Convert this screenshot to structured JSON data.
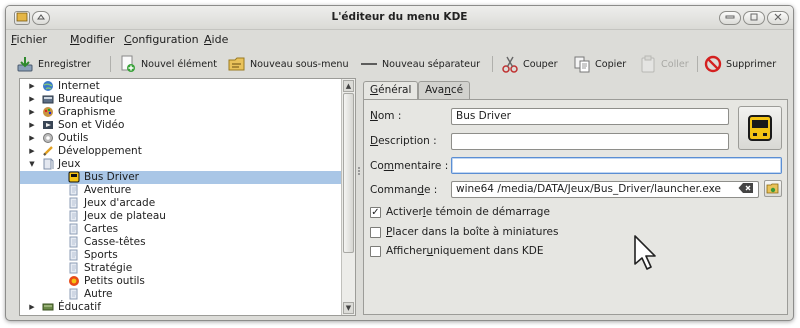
{
  "window": {
    "title": "L'éditeur du menu KDE"
  },
  "menubar": [
    {
      "pre": "",
      "accel": "F",
      "post": "ichier"
    },
    {
      "pre": "",
      "accel": "M",
      "post": "odifier"
    },
    {
      "pre": "",
      "accel": "C",
      "post": "onfiguration"
    },
    {
      "pre": "",
      "accel": "A",
      "post": "ide"
    }
  ],
  "toolbar": {
    "save": "Enregistrer",
    "new_item": "Nouvel élément",
    "new_submenu": "Nouveau sous-menu",
    "new_separator": "Nouveau séparateur",
    "cut": "Couper",
    "copy": "Copier",
    "paste": "Coller",
    "delete": "Supprimer"
  },
  "tree": {
    "items": [
      {
        "label": "Internet",
        "icon": "globe-icon",
        "expanded": false,
        "level": 0
      },
      {
        "label": "Bureautique",
        "icon": "office-icon",
        "expanded": false,
        "level": 0
      },
      {
        "label": "Graphisme",
        "icon": "graphics-icon",
        "expanded": false,
        "level": 0
      },
      {
        "label": "Son et Vidéo",
        "icon": "multimedia-icon",
        "expanded": false,
        "level": 0
      },
      {
        "label": "Outils",
        "icon": "utilities-icon",
        "expanded": false,
        "level": 0
      },
      {
        "label": "Développement",
        "icon": "development-icon",
        "expanded": false,
        "level": 0
      },
      {
        "label": "Jeux",
        "icon": "games-icon",
        "expanded": true,
        "level": 0
      },
      {
        "label": "Bus Driver",
        "icon": "bus-icon",
        "level": 1,
        "selected": true
      },
      {
        "label": "Aventure",
        "icon": "folder-icon",
        "level": 1
      },
      {
        "label": "Jeux d'arcade",
        "icon": "folder-icon",
        "level": 1
      },
      {
        "label": "Jeux de plateau",
        "icon": "folder-icon",
        "level": 1
      },
      {
        "label": "Cartes",
        "icon": "folder-icon",
        "level": 1
      },
      {
        "label": "Casse-têtes",
        "icon": "folder-icon",
        "level": 1
      },
      {
        "label": "Sports",
        "icon": "folder-icon",
        "level": 1
      },
      {
        "label": "Stratégie",
        "icon": "folder-icon",
        "level": 1
      },
      {
        "label": "Petits outils",
        "icon": "toys-icon",
        "level": 1
      },
      {
        "label": "Autre",
        "icon": "folder-icon",
        "level": 1
      },
      {
        "label": "Éducatif",
        "icon": "education-icon",
        "expanded": false,
        "level": 0
      }
    ]
  },
  "tabs": [
    {
      "pre": "",
      "accel": "G",
      "post": "énéral"
    },
    {
      "pre": "Ava",
      "accel": "n",
      "post": "cé"
    }
  ],
  "form": {
    "name_label": {
      "pre": "",
      "accel": "N",
      "post": "om :"
    },
    "name_value": "Bus Driver",
    "description_label": {
      "pre": "",
      "accel": "D",
      "post": "escription :"
    },
    "description_value": "",
    "comment_label": {
      "pre": "Co",
      "accel": "m",
      "post": "mentaire :"
    },
    "comment_value": "",
    "command_label": {
      "pre": "Comman",
      "accel": "d",
      "post": "e :"
    },
    "command_value": "wine64 /media/DATA/Jeux/Bus_Driver/launcher.exe"
  },
  "checkboxes": [
    {
      "pre": "Activer ",
      "accel": "l",
      "post": "e témoin de démarrage",
      "checked": true
    },
    {
      "pre": "",
      "accel": "P",
      "post": "lacer dans la boîte à miniatures",
      "checked": false
    },
    {
      "pre": "Afficher ",
      "accel": "u",
      "post": "niquement dans KDE",
      "checked": false
    }
  ],
  "colors": {
    "selection": "#a9c6e6",
    "focus_border": "#5b8ed3",
    "delete_red": "#d42020"
  }
}
